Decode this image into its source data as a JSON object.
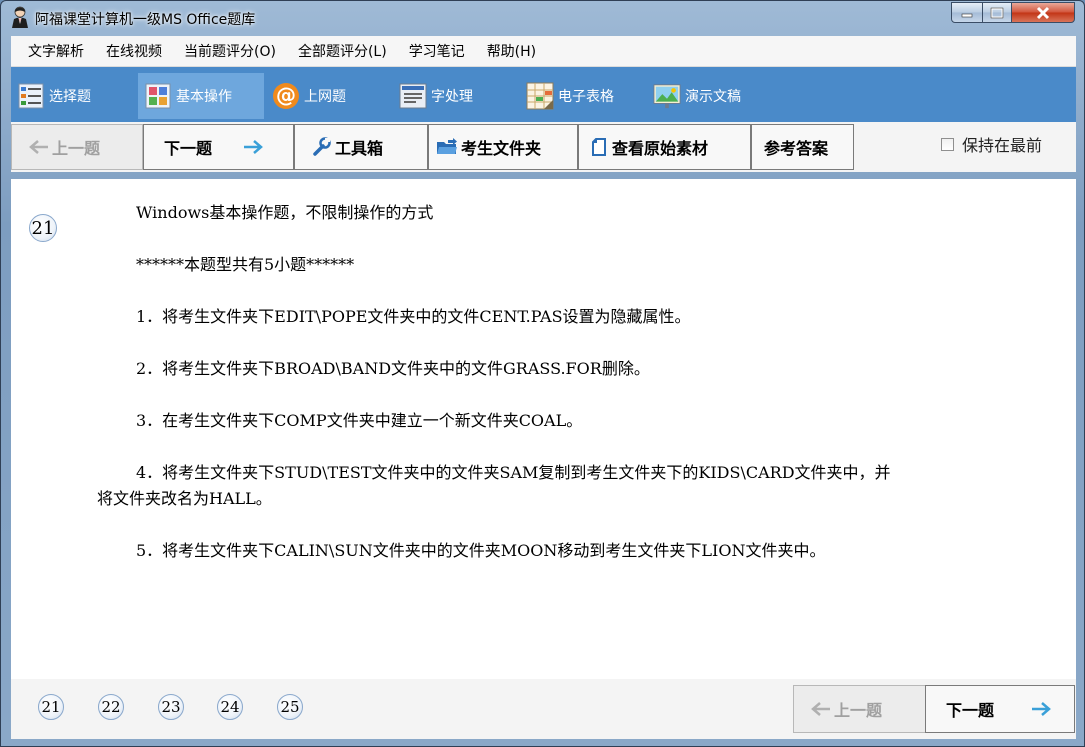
{
  "window": {
    "title": "阿福课堂计算机一级MS Office题库"
  },
  "menu": {
    "items": [
      {
        "label": "文字解析"
      },
      {
        "label": "在线视频"
      },
      {
        "label": "当前题评分(O)"
      },
      {
        "label": "全部题评分(L)"
      },
      {
        "label": "学习笔记"
      },
      {
        "label": "帮助(H)"
      }
    ]
  },
  "nav": {
    "items": [
      {
        "label": "选择题",
        "icon": "list-icon",
        "active": false
      },
      {
        "label": "基本操作",
        "icon": "grid-icon",
        "active": true
      },
      {
        "label": "上网题",
        "icon": "at-icon",
        "active": false
      },
      {
        "label": "字处理",
        "icon": "document-icon",
        "active": false
      },
      {
        "label": "电子表格",
        "icon": "spreadsheet-icon",
        "active": false
      },
      {
        "label": "演示文稿",
        "icon": "presentation-icon",
        "active": false
      }
    ]
  },
  "toolbar": {
    "prev_label": "上一题",
    "next_label": "下一题",
    "tools_label": "工具箱",
    "folder_label": "考生文件夹",
    "source_label": "查看原始素材",
    "answer_label": "参考答案",
    "keep_top_label": "保持在最前",
    "keep_top_checked": false
  },
  "question": {
    "number": "21",
    "heading": "Windows基本操作题，不限制操作的方式",
    "subheading": "******本题型共有5小题******",
    "items": [
      "1．将考生文件夹下EDIT\\POPE文件夹中的文件CENT.PAS设置为隐藏属性。",
      "2．将考生文件夹下BROAD\\BAND文件夹中的文件GRASS.FOR删除。",
      "3．在考生文件夹下COMP文件夹中建立一个新文件夹COAL。",
      "4．将考生文件夹下STUD\\TEST文件夹中的文件夹SAM复制到考生文件夹下的KIDS\\CARD文件夹中，并",
      "将文件夹改名为HALL。",
      "5．将考生文件夹下CALIN\\SUN文件夹中的文件夹MOON移动到考生文件夹下LION文件夹中。"
    ]
  },
  "footer": {
    "question_numbers": [
      "21",
      "22",
      "23",
      "24",
      "25"
    ],
    "prev_label": "上一题",
    "next_label": "下一题"
  },
  "colors": {
    "nav_bg": "#4a8ac9",
    "nav_active": "#6ea7dd",
    "arrow_accent": "#3aa0d8"
  }
}
